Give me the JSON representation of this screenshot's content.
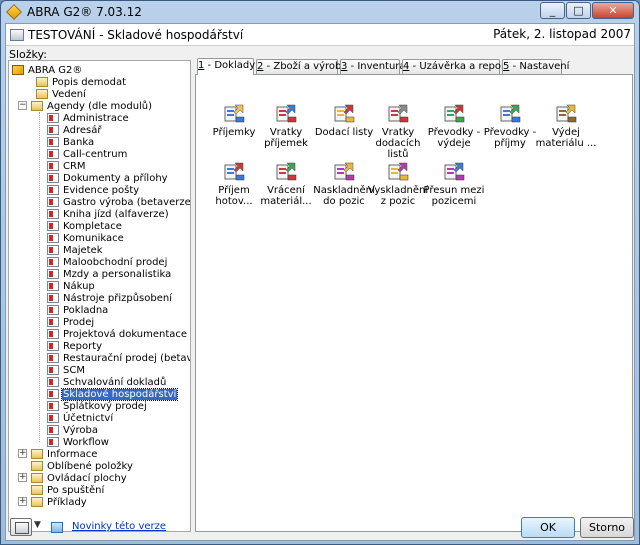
{
  "window": {
    "title": "ABRA G2® 7.03.12",
    "controls": {
      "minimize": "_",
      "maximize": "□",
      "close": "✕"
    }
  },
  "header": {
    "title": "TESTOVÁNÍ - Skladové hospodářství",
    "date": "Pátek, 2. listopad 2007"
  },
  "folders_label": "Složky:",
  "tree": {
    "root": "ABRA G2®",
    "top_items": [
      "Popis demodat",
      "Vedení",
      "Agendy (dle modulů)"
    ],
    "agendy": [
      "Administrace",
      "Adresář",
      "Banka",
      "Call-centrum",
      "CRM",
      "Dokumenty a přílohy",
      "Evidence pošty",
      "Gastro výroba (betaverze)",
      "Kniha jízd (alfaverze)",
      "Kompletace",
      "Komunikace",
      "Majetek",
      "Maloobchodní prodej",
      "Mzdy a personalistika",
      "Nákup",
      "Nástroje přizpůsobení",
      "Pokladna",
      "Prodej",
      "Projektová dokumentace",
      "Reporty",
      "Restaurační prodej (betaverze)",
      "SCM",
      "Schvalování dokladů",
      "Skladové hospodářství",
      "Splátkový prodej",
      "Účetnictví",
      "Výroba",
      "Workflow"
    ],
    "selected": "Skladové hospodářství",
    "bottom_items": [
      "Informace",
      "Oblíbené položky",
      "Ovládací plochy",
      "Po spuštění",
      "Příklady"
    ]
  },
  "tabs": [
    {
      "num": "1",
      "label": " - Doklady"
    },
    {
      "num": "2",
      "label": " - Zboží a výrobky"
    },
    {
      "num": "3",
      "label": " - Inventura"
    },
    {
      "num": "4",
      "label": " - Uzávěrka a reporty"
    },
    {
      "num": "5",
      "label": " - Nastavení"
    }
  ],
  "tiles": [
    {
      "label": "Příjemky",
      "icon": "receipt-forklift-icon"
    },
    {
      "label": "Vratky příjemek",
      "icon": "return-receipt-icon"
    },
    {
      "label": "Dodací listy",
      "icon": "delivery-note-icon"
    },
    {
      "label": "Vratky dodacích listů",
      "icon": "return-delivery-icon"
    },
    {
      "label": "Převodky - výdeje",
      "icon": "transfer-out-icon"
    },
    {
      "label": "Převodky - příjmy",
      "icon": "transfer-in-icon"
    },
    {
      "label": "Výdej materiálu ...",
      "icon": "material-issue-icon"
    },
    {
      "label": "Příjem hotov...",
      "icon": "finished-goods-receipt-icon"
    },
    {
      "label": "Vrácení materiál...",
      "icon": "material-return-icon"
    },
    {
      "label": "Naskladnění do pozic",
      "icon": "stock-into-positions-icon"
    },
    {
      "label": "Vyskladnění z pozic",
      "icon": "stock-out-positions-icon"
    },
    {
      "label": "Přesun mezi pozicemi",
      "icon": "move-between-positions-icon"
    }
  ],
  "footer": {
    "news_link": "Novinky této verze",
    "ok": "OK",
    "cancel": "Storno"
  }
}
